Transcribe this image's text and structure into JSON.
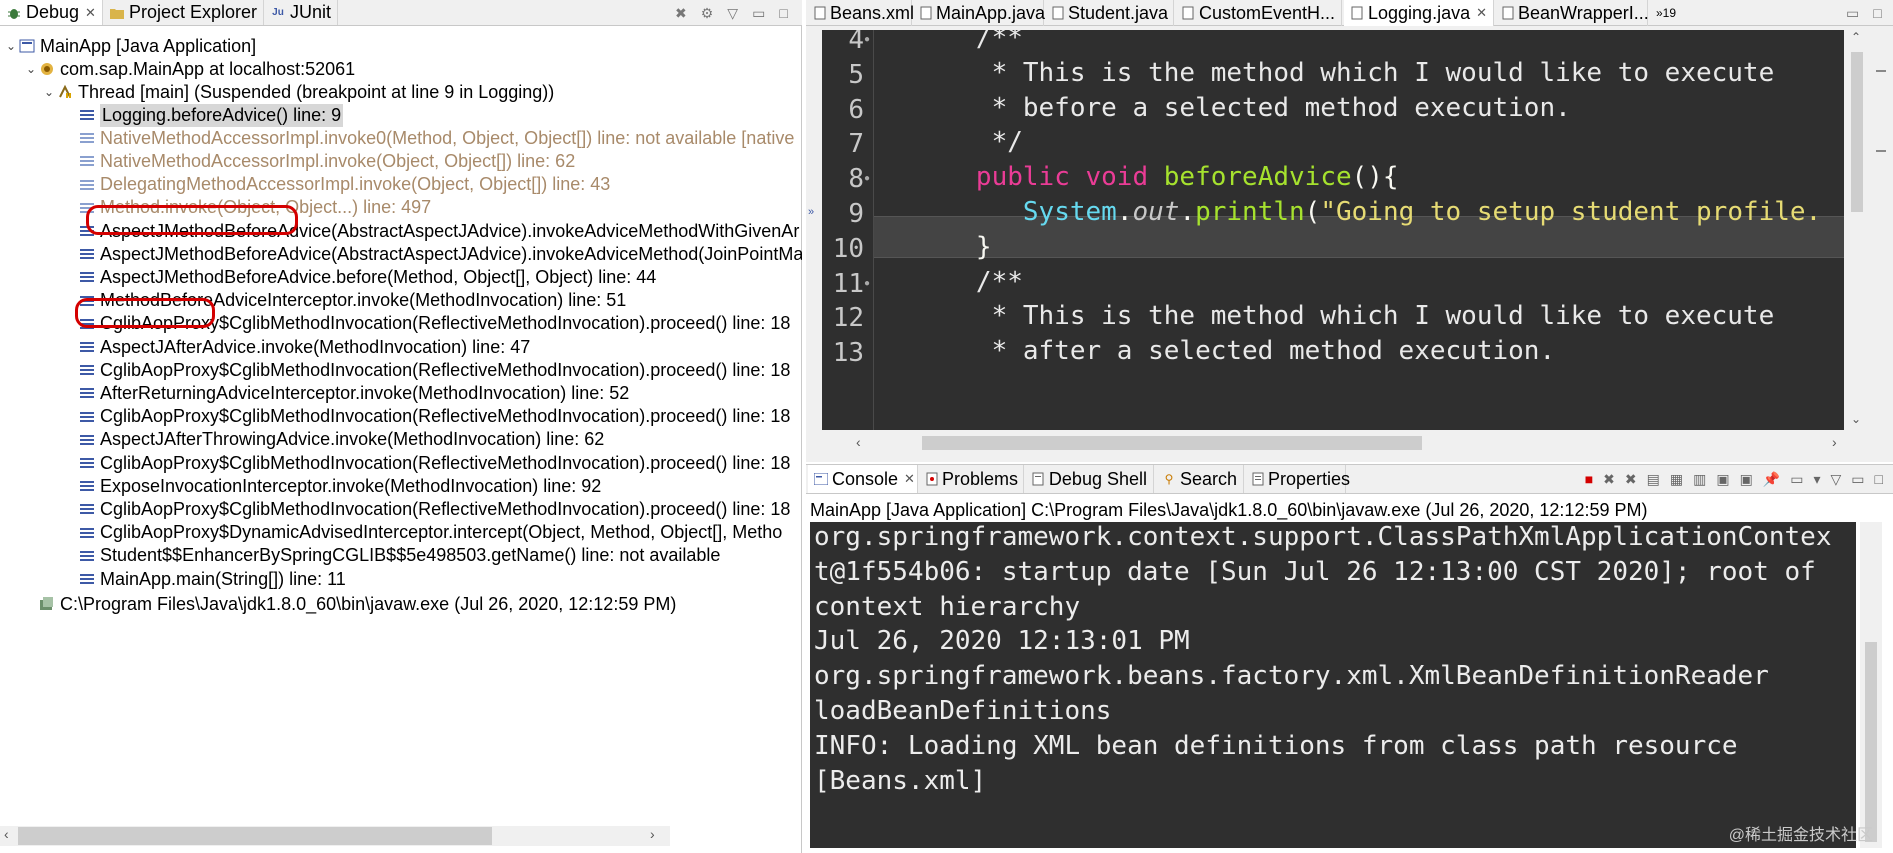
{
  "debug_tabs": [
    {
      "label": "Debug",
      "icon": "bug-icon",
      "active": true
    },
    {
      "label": "Project Explorer",
      "icon": "folder-icon",
      "active": false
    },
    {
      "label": "JUnit",
      "icon": "junit-icon",
      "active": false
    }
  ],
  "debug_tree": {
    "launch": "MainApp [Java Application]",
    "target": "com.sap.MainApp at localhost:52061",
    "thread": "Thread [main] (Suspended (breakpoint at line 9 in Logging))",
    "frames": [
      {
        "text": "Logging.beforeAdvice() line: 9",
        "style": "selected"
      },
      {
        "text": "NativeMethodAccessorImpl.invoke0(Method, Object, Object[]) line: not available [native",
        "style": "grey"
      },
      {
        "text": "NativeMethodAccessorImpl.invoke(Object, Object[]) line: 62",
        "style": "grey"
      },
      {
        "text": "DelegatingMethodAccessorImpl.invoke(Object, Object[]) line: 43",
        "style": "grey"
      },
      {
        "text": "Method.invoke(Object, Object...) line: 497",
        "style": "grey"
      },
      {
        "text": "AspectJMethodBeforeAdvice(AbstractAspectJAdvice).invokeAdviceMethodWithGivenAr",
        "style": "normal"
      },
      {
        "text": "AspectJMethodBeforeAdvice(AbstractAspectJAdvice).invokeAdviceMethod(JoinPointMa",
        "style": "normal"
      },
      {
        "text": "AspectJMethodBeforeAdvice.before(Method, Object[], Object) line: 44",
        "style": "normal"
      },
      {
        "text": "MethodBeforeAdviceInterceptor.invoke(MethodInvocation) line: 51",
        "style": "normal"
      },
      {
        "text": "CglibAopProxy$CglibMethodInvocation(ReflectiveMethodInvocation).proceed() line: 18",
        "style": "normal"
      },
      {
        "text": "AspectJAfterAdvice.invoke(MethodInvocation) line: 47",
        "style": "normal"
      },
      {
        "text": "CglibAopProxy$CglibMethodInvocation(ReflectiveMethodInvocation).proceed() line: 18",
        "style": "normal"
      },
      {
        "text": "AfterReturningAdviceInterceptor.invoke(MethodInvocation) line: 52",
        "style": "normal"
      },
      {
        "text": "CglibAopProxy$CglibMethodInvocation(ReflectiveMethodInvocation).proceed() line: 18",
        "style": "normal"
      },
      {
        "text": "AspectJAfterThrowingAdvice.invoke(MethodInvocation) line: 62",
        "style": "normal"
      },
      {
        "text": "CglibAopProxy$CglibMethodInvocation(ReflectiveMethodInvocation).proceed() line: 18",
        "style": "normal"
      },
      {
        "text": "ExposeInvocationInterceptor.invoke(MethodInvocation) line: 92",
        "style": "normal"
      },
      {
        "text": "CglibAopProxy$CglibMethodInvocation(ReflectiveMethodInvocation).proceed() line: 18",
        "style": "normal"
      },
      {
        "text": "CglibAopProxy$DynamicAdvisedInterceptor.intercept(Object, Method, Object[], Metho",
        "style": "normal"
      },
      {
        "text": "Student$$EnhancerBySpringCGLIB$$5e498503.getName() line: not available",
        "style": "normal"
      },
      {
        "text": "MainApp.main(String[]) line: 11",
        "style": "normal"
      }
    ],
    "process": "C:\\Program Files\\Java\\jdk1.8.0_60\\bin\\javaw.exe (Jul 26, 2020, 12:12:59 PM)"
  },
  "editor_tabs": [
    {
      "label": "Beans.xml",
      "active": false
    },
    {
      "label": "MainApp.java",
      "active": false
    },
    {
      "label": "Student.java",
      "active": false
    },
    {
      "label": "CustomEventH...",
      "active": false
    },
    {
      "label": "Logging.java",
      "active": true
    },
    {
      "label": "BeanWrapperI...",
      "active": false
    }
  ],
  "editor_overflow": "»19",
  "code_lines": [
    {
      "num": "4",
      "fold": true,
      "tokens": [
        {
          "t": "      /**",
          "c": "cmt"
        }
      ]
    },
    {
      "num": "5",
      "fold": false,
      "tokens": [
        {
          "t": "       * This is the method which I would like to execute",
          "c": "cmt"
        }
      ]
    },
    {
      "num": "6",
      "fold": false,
      "tokens": [
        {
          "t": "       * before a selected method execution.",
          "c": "cmt"
        }
      ]
    },
    {
      "num": "7",
      "fold": false,
      "tokens": [
        {
          "t": "       */",
          "c": "cmt"
        }
      ]
    },
    {
      "num": "8",
      "fold": true,
      "tokens": [
        {
          "t": "      ",
          "c": "op"
        },
        {
          "t": "public",
          "c": "kw"
        },
        {
          "t": " ",
          "c": "op"
        },
        {
          "t": "void",
          "c": "kw"
        },
        {
          "t": " ",
          "c": "op"
        },
        {
          "t": "beforeAdvice",
          "c": "fn"
        },
        {
          "t": "(){",
          "c": "op"
        }
      ]
    },
    {
      "num": "9",
      "fold": false,
      "current": true,
      "tokens": [
        {
          "t": "         ",
          "c": "op"
        },
        {
          "t": "System",
          "c": "cls"
        },
        {
          "t": ".",
          "c": "op"
        },
        {
          "t": "out",
          "c": "fld"
        },
        {
          "t": ".",
          "c": "op"
        },
        {
          "t": "println",
          "c": "fn"
        },
        {
          "t": "(",
          "c": "op"
        },
        {
          "t": "\"Going to setup student profile.",
          "c": "str"
        }
      ]
    },
    {
      "num": "10",
      "fold": false,
      "tokens": [
        {
          "t": "      }",
          "c": "op"
        }
      ]
    },
    {
      "num": "11",
      "fold": true,
      "tokens": [
        {
          "t": "      /**",
          "c": "cmt"
        }
      ]
    },
    {
      "num": "12",
      "fold": false,
      "tokens": [
        {
          "t": "       * This is the method which I would like to execute",
          "c": "cmt"
        }
      ]
    },
    {
      "num": "13",
      "fold": false,
      "tokens": [
        {
          "t": "       * after a selected method execution.",
          "c": "cmt"
        }
      ]
    }
  ],
  "console_tabs": [
    {
      "label": "Console",
      "icon": "console-icon",
      "active": true,
      "close": true
    },
    {
      "label": "Problems",
      "icon": "problems-icon",
      "active": false
    },
    {
      "label": "Debug Shell",
      "icon": "debug-shell-icon",
      "active": false
    },
    {
      "label": "Search",
      "icon": "search-icon",
      "active": false
    },
    {
      "label": "Properties",
      "icon": "properties-icon",
      "active": false
    }
  ],
  "console_label": "MainApp [Java Application] C:\\Program Files\\Java\\jdk1.8.0_60\\bin\\javaw.exe (Jul 26, 2020, 12:12:59 PM)",
  "console_lines": [
    "org.springframework.context.support.ClassPathXmlApplicationContex",
    "t@1f554b06: startup date [Sun Jul 26 12:13:00 CST 2020]; root of",
    "context hierarchy",
    "Jul 26, 2020 12:13:01 PM",
    "org.springframework.beans.factory.xml.XmlBeanDefinitionReader",
    "loadBeanDefinitions",
    "INFO: Loading XML bean definitions from class path resource",
    "[Beans.xml]"
  ],
  "watermark": "@稀土掘金技术社区",
  "colors": {
    "highlight_oval": "#d40000",
    "editor_bg": "#2f2f2f",
    "keyword": "#ea3c96",
    "method": "#a6e22e",
    "string": "#e6db74",
    "class": "#66d9ef"
  }
}
